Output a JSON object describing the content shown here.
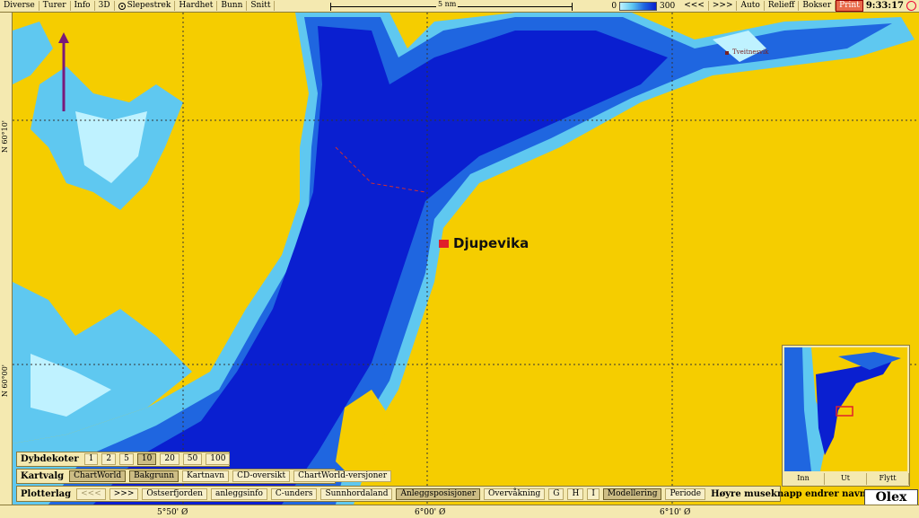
{
  "toolbar": {
    "menu": [
      "Diverse",
      "Turer",
      "Info",
      "3D",
      "Slepestrek",
      "Hardhet",
      "Bunn",
      "Snitt"
    ],
    "scale_label": "5 nm",
    "depth_min": "0",
    "depth_max": "300",
    "tools": [
      "<<<",
      ">>>",
      "Auto",
      "Relieff",
      "Bokser"
    ],
    "print_label": "Print",
    "clock": "9:33:17"
  },
  "map": {
    "place_name": "Djupevika",
    "small_place": "Tveitnesvik",
    "lat_labels": [
      "N 60°10'",
      "N 60°00'"
    ],
    "lon_labels": [
      "5°50' Ø",
      "6°00' Ø",
      "6°10' Ø"
    ],
    "colors": {
      "land": "#f5cd00",
      "deep": "#0a1fd0",
      "mid": "#1f66e0",
      "shallow": "#5fc8f0",
      "veryshallow": "#bff2ff"
    }
  },
  "depth_panel": {
    "label": "Dybdekoter",
    "options": [
      "1",
      "2",
      "5",
      "10",
      "20",
      "50",
      "100"
    ],
    "selected": "10"
  },
  "chart_panel": {
    "label": "Kartvalg",
    "options": [
      "ChartWorld",
      "Bakgrunn",
      "Kartnavn",
      "CD-oversikt",
      "ChartWorld-versjoner"
    ]
  },
  "plot_panel": {
    "label": "Plotterlag",
    "options": [
      "<<<",
      ">>>",
      "Ostserfjorden",
      "anleggsinfo",
      "C-unders",
      "Sunnhordaland",
      "Anleggsposisjoner",
      "Overvåkning",
      "G",
      "H",
      "I",
      "Modellering",
      "Periode"
    ],
    "hint": "Høyre museknapp endrer navn"
  },
  "inset": {
    "buttons": [
      "Inn",
      "Ut",
      "Flytt"
    ]
  },
  "brand": "Olex"
}
